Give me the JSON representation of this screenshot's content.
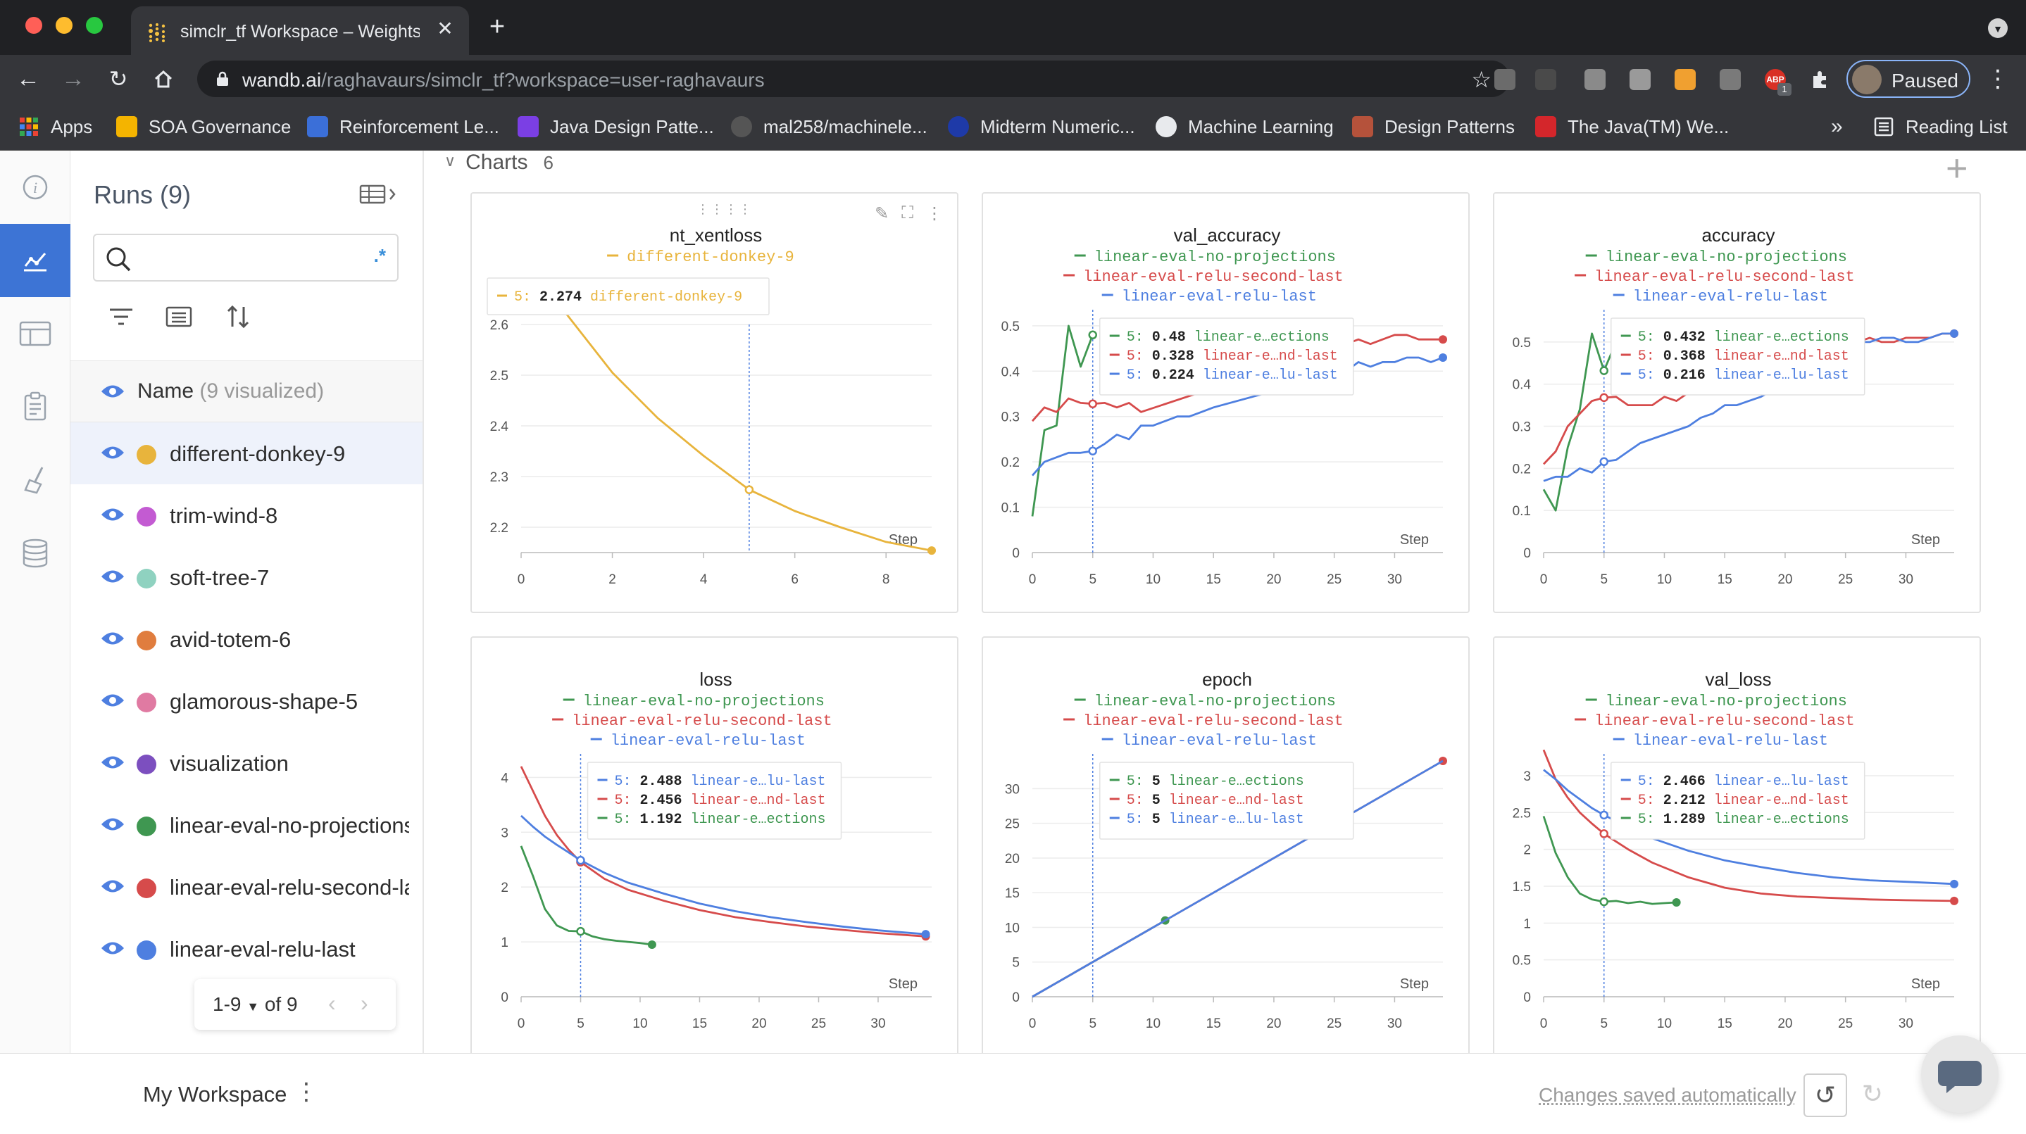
{
  "browser": {
    "tab_title": "simclr_tf Workspace – Weights & Biases",
    "url_host": "wandb.ai",
    "url_path": "/raghavaurs/simclr_tf?workspace=user-raghavaurs",
    "profile_label": "Paused",
    "ext_badge": "1",
    "ext_abp": "ABP",
    "bookmarks": [
      {
        "label": "Apps",
        "icon": "apps-grid-icon",
        "color": "#e8453c"
      },
      {
        "label": "SOA Governance",
        "icon": "soa-icon",
        "color": "#f4b400"
      },
      {
        "label": "Reinforcement Le...",
        "icon": "uw-icon",
        "color": "#3b6fd8"
      },
      {
        "label": "Java Design Patte...",
        "icon": "java-d-icon",
        "color": "#7b3fe4"
      },
      {
        "label": "mal258/machinele...",
        "icon": "github-icon",
        "color": "#555555"
      },
      {
        "label": "Midterm Numeric...",
        "icon": "midterm-icon",
        "color": "#1e3aa8"
      },
      {
        "label": "Machine Learning",
        "icon": "globe-icon",
        "color": "#e8eaed"
      },
      {
        "label": "Design Patterns",
        "icon": "design-icon",
        "color": "#b5523b"
      },
      {
        "label": "The Java(TM) We...",
        "icon": "oracle-icon",
        "color": "#d4262b"
      }
    ],
    "bookmarks_more": "»",
    "reading_list": "Reading List"
  },
  "sidebar": {
    "runs_title": "Runs (9)",
    "search_placeholder": "",
    "regex_label": ".*",
    "name_header": "Name",
    "name_header_count": "(9 visualized)",
    "runs": [
      {
        "name": "different-donkey-9",
        "color": "#e8b43c",
        "selected": true
      },
      {
        "name": "trim-wind-8",
        "color": "#c35bd2"
      },
      {
        "name": "soft-tree-7",
        "color": "#8fd2c0"
      },
      {
        "name": "avid-totem-6",
        "color": "#e07d3e"
      },
      {
        "name": "glamorous-shape-5",
        "color": "#e07aa2"
      },
      {
        "name": "visualization",
        "color": "#7c4fbf"
      },
      {
        "name": "linear-eval-no-projections",
        "color": "#3f9751"
      },
      {
        "name": "linear-eval-relu-second-last",
        "color": "#d64b4b"
      },
      {
        "name": "linear-eval-relu-last",
        "color": "#4e7fe0"
      }
    ],
    "pager_range": "1-9",
    "pager_of": "of 9"
  },
  "main": {
    "section_title": "Charts",
    "section_count": "6"
  },
  "footer": {
    "workspace_label": "My Workspace",
    "saved_label": "Changes saved automatically"
  },
  "chart_data": [
    {
      "title": "nt_xentloss",
      "type": "line",
      "xlabel": "Step",
      "ylabel": "",
      "xlim": [
        0,
        9
      ],
      "ylim": [
        2.15,
        2.65
      ],
      "xticks": [
        0,
        2,
        4,
        6,
        8
      ],
      "yticks": [
        2.2,
        2.3,
        2.4,
        2.5,
        2.6
      ],
      "cursor_x": 5,
      "tooltip": [
        {
          "step": "5:",
          "value": "2.274",
          "label": "different-donkey-9",
          "color": "#e8b43c"
        }
      ],
      "series": [
        {
          "name": "different-donkey-9",
          "color": "#e8b43c",
          "end_dot": true,
          "x": [
            1,
            2,
            3,
            4,
            5,
            6,
            7,
            8,
            9
          ],
          "y": [
            2.62,
            2.505,
            2.415,
            2.341,
            2.274,
            2.232,
            2.2,
            2.171,
            2.154
          ]
        }
      ]
    },
    {
      "title": "val_accuracy",
      "type": "line",
      "xlabel": "Step",
      "ylabel": "",
      "xlim": [
        0,
        34
      ],
      "ylim": [
        0,
        0.52
      ],
      "xticks": [
        0,
        5,
        10,
        15,
        20,
        25,
        30
      ],
      "yticks": [
        0,
        0.1,
        0.2,
        0.3,
        0.4,
        0.5
      ],
      "cursor_x": 5,
      "tooltip": [
        {
          "step": "5:",
          "value": "0.48",
          "label": "linear-e…ections",
          "color": "#3f9751"
        },
        {
          "step": "5:",
          "value": "0.328",
          "label": "linear-e…nd-last",
          "color": "#d64b4b"
        },
        {
          "step": "5:",
          "value": "0.224",
          "label": "linear-e…lu-last",
          "color": "#4e7fe0"
        }
      ],
      "series": [
        {
          "name": "linear-eval-no-projections",
          "color": "#3f9751",
          "x": [
            0,
            1,
            2,
            3,
            4,
            5
          ],
          "y": [
            0.08,
            0.27,
            0.28,
            0.5,
            0.41,
            0.48
          ]
        },
        {
          "name": "linear-eval-relu-second-last",
          "color": "#d64b4b",
          "end_dot": true,
          "x": [
            0,
            1,
            2,
            3,
            4,
            5,
            6,
            7,
            8,
            9,
            26,
            27,
            28,
            29,
            30,
            31,
            32,
            33,
            34
          ],
          "y": [
            0.29,
            0.32,
            0.31,
            0.34,
            0.33,
            0.328,
            0.33,
            0.32,
            0.33,
            0.31,
            0.46,
            0.47,
            0.46,
            0.47,
            0.48,
            0.48,
            0.47,
            0.47,
            0.47
          ]
        },
        {
          "name": "linear-eval-relu-last",
          "color": "#4e7fe0",
          "end_dot": true,
          "x": [
            0,
            1,
            2,
            3,
            4,
            5,
            6,
            7,
            8,
            9,
            10,
            11,
            12,
            13,
            14,
            15,
            26,
            27,
            28,
            29,
            30,
            31,
            32,
            33,
            34
          ],
          "y": [
            0.17,
            0.2,
            0.21,
            0.22,
            0.22,
            0.224,
            0.24,
            0.26,
            0.25,
            0.28,
            0.28,
            0.29,
            0.3,
            0.3,
            0.31,
            0.32,
            0.4,
            0.42,
            0.41,
            0.42,
            0.42,
            0.43,
            0.43,
            0.42,
            0.43
          ]
        }
      ]
    },
    {
      "title": "accuracy",
      "type": "line",
      "xlabel": "Step",
      "ylabel": "",
      "xlim": [
        0,
        34
      ],
      "ylim": [
        0,
        0.56
      ],
      "xticks": [
        0,
        5,
        10,
        15,
        20,
        25,
        30
      ],
      "yticks": [
        0,
        0.1,
        0.2,
        0.3,
        0.4,
        0.5
      ],
      "cursor_x": 5,
      "tooltip": [
        {
          "step": "5:",
          "value": "0.432",
          "label": "linear-e…ections",
          "color": "#3f9751"
        },
        {
          "step": "5:",
          "value": "0.368",
          "label": "linear-e…nd-last",
          "color": "#d64b4b"
        },
        {
          "step": "5:",
          "value": "0.216",
          "label": "linear-e…lu-last",
          "color": "#4e7fe0"
        }
      ],
      "series": [
        {
          "name": "linear-eval-no-projections",
          "color": "#3f9751",
          "x": [
            0,
            1,
            2,
            3,
            4,
            5,
            6
          ],
          "y": [
            0.15,
            0.1,
            0.25,
            0.34,
            0.52,
            0.432,
            0.5
          ]
        },
        {
          "name": "linear-eval-relu-second-last",
          "color": "#d64b4b",
          "end_dot": true,
          "x": [
            0,
            1,
            2,
            3,
            4,
            5,
            6,
            7,
            8,
            9,
            10,
            11,
            12,
            26,
            27,
            28,
            29,
            30,
            31,
            32,
            33,
            34
          ],
          "y": [
            0.21,
            0.24,
            0.3,
            0.33,
            0.36,
            0.368,
            0.37,
            0.35,
            0.35,
            0.35,
            0.37,
            0.36,
            0.38,
            0.5,
            0.51,
            0.5,
            0.5,
            0.51,
            0.51,
            0.51,
            0.52,
            0.52
          ]
        },
        {
          "name": "linear-eval-relu-last",
          "color": "#4e7fe0",
          "end_dot": true,
          "x": [
            0,
            1,
            2,
            3,
            4,
            5,
            6,
            7,
            8,
            9,
            10,
            11,
            12,
            13,
            14,
            15,
            16,
            17,
            18,
            26,
            27,
            28,
            29,
            30,
            31,
            32,
            33,
            34
          ],
          "y": [
            0.17,
            0.18,
            0.18,
            0.2,
            0.19,
            0.216,
            0.22,
            0.24,
            0.26,
            0.27,
            0.28,
            0.29,
            0.3,
            0.32,
            0.33,
            0.35,
            0.35,
            0.36,
            0.37,
            0.5,
            0.5,
            0.51,
            0.51,
            0.5,
            0.5,
            0.51,
            0.52,
            0.52
          ]
        }
      ]
    },
    {
      "title": "loss",
      "type": "line",
      "xlabel": "Step",
      "ylabel": "",
      "xlim": [
        0,
        34.5
      ],
      "ylim": [
        0,
        4.3
      ],
      "xticks": [
        0,
        5,
        10,
        15,
        20,
        25,
        30
      ],
      "yticks": [
        0,
        1,
        2,
        3,
        4
      ],
      "cursor_x": 5,
      "tooltip": [
        {
          "step": "5:",
          "value": "2.488",
          "label": "linear-e…lu-last",
          "color": "#4e7fe0"
        },
        {
          "step": "5:",
          "value": "2.456",
          "label": "linear-e…nd-last",
          "color": "#d64b4b"
        },
        {
          "step": "5:",
          "value": "1.192",
          "label": "linear-e…ections",
          "color": "#3f9751"
        }
      ],
      "series": [
        {
          "name": "linear-eval-no-projections",
          "color": "#3f9751",
          "end_dot": true,
          "x": [
            0,
            1,
            2,
            3,
            4,
            5,
            6,
            7,
            8,
            9,
            10,
            11
          ],
          "y": [
            2.75,
            2.2,
            1.6,
            1.3,
            1.2,
            1.192,
            1.1,
            1.05,
            1.02,
            1.0,
            0.98,
            0.95
          ]
        },
        {
          "name": "linear-eval-relu-second-last",
          "color": "#d64b4b",
          "end_dot": true,
          "x": [
            0,
            1,
            2,
            3,
            4,
            5,
            7,
            9,
            12,
            15,
            18,
            21,
            24,
            27,
            30,
            34
          ],
          "y": [
            4.2,
            3.75,
            3.3,
            2.95,
            2.68,
            2.456,
            2.15,
            1.95,
            1.75,
            1.58,
            1.45,
            1.36,
            1.28,
            1.22,
            1.16,
            1.1
          ]
        },
        {
          "name": "linear-eval-relu-last",
          "color": "#4e7fe0",
          "end_dot": true,
          "x": [
            0,
            1,
            2,
            3,
            4,
            5,
            7,
            9,
            12,
            15,
            18,
            21,
            24,
            27,
            30,
            34
          ],
          "y": [
            3.3,
            3.1,
            2.92,
            2.77,
            2.63,
            2.488,
            2.26,
            2.08,
            1.88,
            1.7,
            1.56,
            1.45,
            1.36,
            1.28,
            1.21,
            1.14
          ]
        }
      ]
    },
    {
      "title": "epoch",
      "type": "line",
      "xlabel": "Step",
      "ylabel": "",
      "xlim": [
        0,
        34
      ],
      "ylim": [
        0,
        34
      ],
      "xticks": [
        0,
        5,
        10,
        15,
        20,
        25,
        30
      ],
      "yticks": [
        0,
        5,
        10,
        15,
        20,
        25,
        30
      ],
      "cursor_x": 5,
      "tooltip": [
        {
          "step": "5:",
          "value": "5",
          "label": "linear-e…ections",
          "color": "#3f9751"
        },
        {
          "step": "5:",
          "value": "5",
          "label": "linear-e…nd-last",
          "color": "#d64b4b"
        },
        {
          "step": "5:",
          "value": "5",
          "label": "linear-e…lu-last",
          "color": "#4e7fe0"
        }
      ],
      "series": [
        {
          "name": "linear-eval-no-projections",
          "color": "#3f9751",
          "end_dot": true,
          "x": [
            0,
            11
          ],
          "y": [
            0,
            11
          ]
        },
        {
          "name": "linear-eval-relu-second-last",
          "color": "#d64b4b",
          "end_dot": true,
          "x": [
            0,
            34
          ],
          "y": [
            0,
            34
          ]
        },
        {
          "name": "linear-eval-relu-last",
          "color": "#4e7fe0",
          "x": [
            0,
            34
          ],
          "y": [
            0,
            34
          ]
        }
      ]
    },
    {
      "title": "val_loss",
      "type": "line",
      "xlabel": "Step",
      "ylabel": "",
      "xlim": [
        0,
        34
      ],
      "ylim": [
        0,
        3.2
      ],
      "xticks": [
        0,
        5,
        10,
        15,
        20,
        25,
        30
      ],
      "yticks": [
        0,
        0.5,
        1,
        1.5,
        2,
        2.5,
        3
      ],
      "cursor_x": 5,
      "tooltip": [
        {
          "step": "5:",
          "value": "2.466",
          "label": "linear-e…lu-last",
          "color": "#4e7fe0"
        },
        {
          "step": "5:",
          "value": "2.212",
          "label": "linear-e…nd-last",
          "color": "#d64b4b"
        },
        {
          "step": "5:",
          "value": "1.289",
          "label": "linear-e…ections",
          "color": "#3f9751"
        }
      ],
      "series": [
        {
          "name": "linear-eval-no-projections",
          "color": "#3f9751",
          "end_dot": true,
          "x": [
            0,
            1,
            2,
            3,
            4,
            5,
            6,
            7,
            8,
            9,
            10,
            11
          ],
          "y": [
            2.45,
            1.95,
            1.62,
            1.4,
            1.32,
            1.289,
            1.3,
            1.27,
            1.29,
            1.26,
            1.27,
            1.28
          ]
        },
        {
          "name": "linear-eval-relu-second-last",
          "color": "#d64b4b",
          "end_dot": true,
          "x": [
            0,
            1,
            2,
            3,
            4,
            5,
            7,
            9,
            12,
            15,
            18,
            21,
            24,
            27,
            30,
            34
          ],
          "y": [
            3.35,
            2.95,
            2.7,
            2.5,
            2.35,
            2.212,
            2.0,
            1.82,
            1.62,
            1.48,
            1.4,
            1.36,
            1.34,
            1.32,
            1.31,
            1.3
          ]
        },
        {
          "name": "linear-eval-relu-last",
          "color": "#4e7fe0",
          "end_dot": true,
          "x": [
            0,
            1,
            2,
            3,
            4,
            5,
            7,
            9,
            12,
            15,
            18,
            21,
            24,
            27,
            30,
            34
          ],
          "y": [
            3.08,
            2.95,
            2.8,
            2.68,
            2.56,
            2.466,
            2.3,
            2.15,
            1.98,
            1.85,
            1.76,
            1.68,
            1.62,
            1.58,
            1.56,
            1.53
          ]
        }
      ]
    }
  ]
}
